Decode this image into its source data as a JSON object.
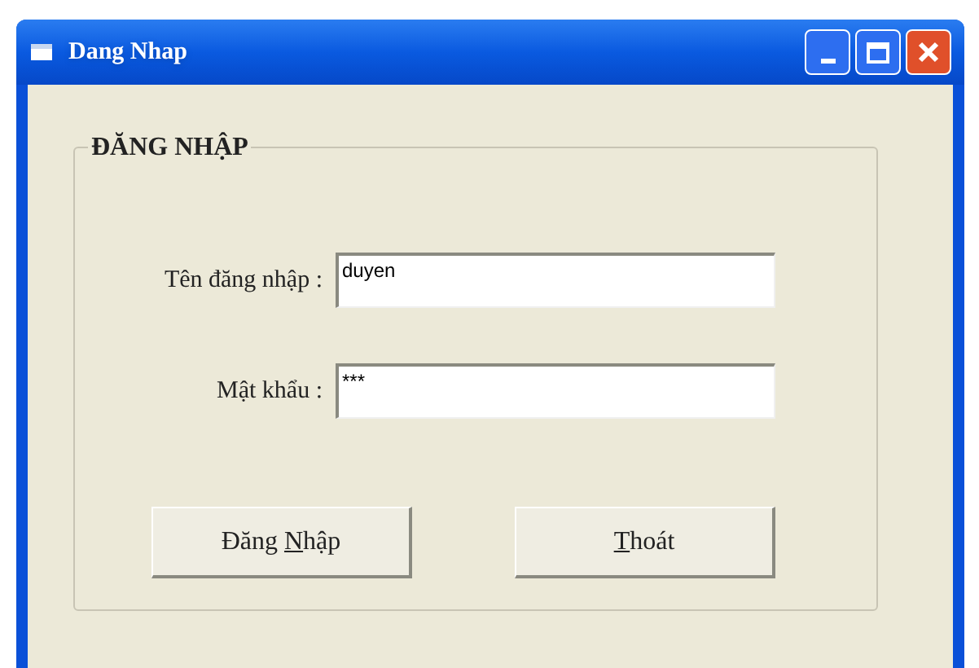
{
  "window": {
    "title": "Dang Nhap"
  },
  "group": {
    "caption": "ĐĂNG NHẬP"
  },
  "fields": [
    {
      "label": "Tên đăng nhập :",
      "value": "duyen"
    },
    {
      "label": "Mật khẩu :",
      "value": "***"
    }
  ],
  "buttons": [
    {
      "label_start": "Đăng ",
      "access_key": "N",
      "label_end": "hập"
    },
    {
      "access_key": "T",
      "label_end": "hoát"
    }
  ]
}
